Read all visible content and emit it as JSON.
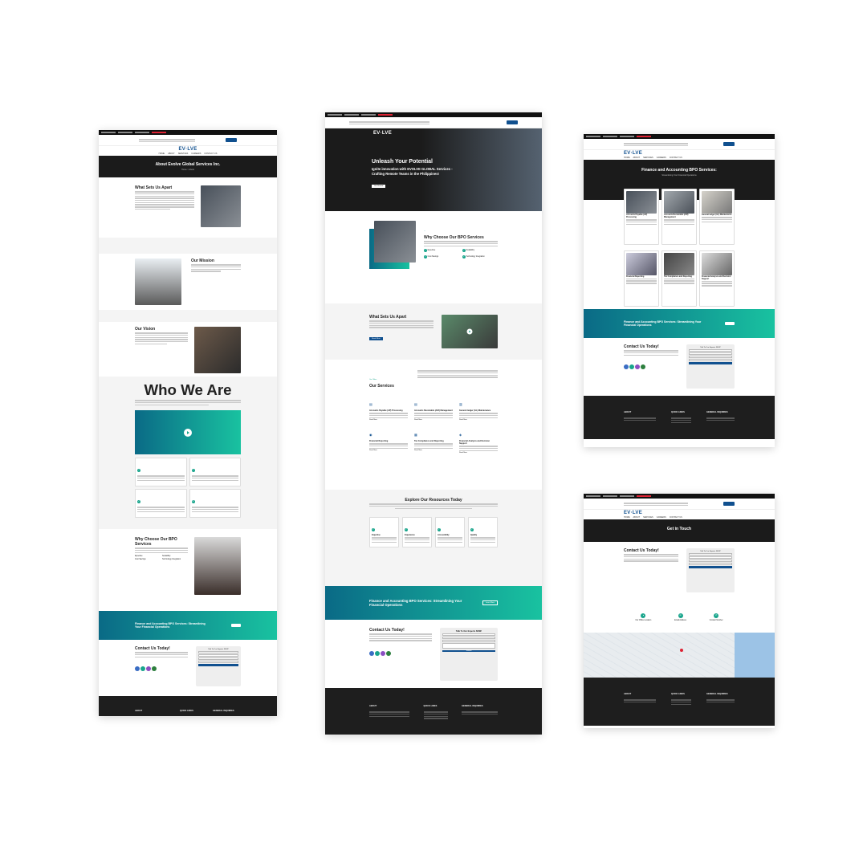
{
  "brand": {
    "logo": "EV·LVE",
    "primary": "#10508f",
    "accent": "#19c2a0",
    "dark": "#1e1e1e"
  },
  "nav": [
    "HOME",
    "ABOUT",
    "SERVICES",
    "CAREERS",
    "CONTACT US"
  ],
  "about_page": {
    "hero_title": "About Evolve Global Services Inc.",
    "hero_breadcrumb": "Home > About",
    "sets_apart": "What Sets Us Apart",
    "mission": "Our Mission",
    "vision": "Our Vision",
    "who_we_are": "Who We Are",
    "why_choose": "Why Choose Our BPO Services",
    "why_items": [
      "Expertise",
      "Scalability",
      "Cost Savings",
      "Technology Integration"
    ],
    "banner": "Finance and Accounting BPO Services: Streamlining Your Financial Operations",
    "contact": "Contact Us Today!",
    "form_title": "Talk To Our Experts NOW!",
    "footer": [
      "ABOUT",
      "QUICK LINKS",
      "GENERAL INQUIRIES"
    ]
  },
  "home_page": {
    "hero_title": "Unleash Your Potential",
    "hero_sub": "Ignite innovation with EVOLVE GLOBAL Services - Crafting Remote Teams in the Philippines!",
    "hero_btn": "Get Started",
    "why_choose": "Why Choose Our BPO Services",
    "why_items": [
      "Expertise",
      "Scalability",
      "Cost Savings",
      "Technology Integration"
    ],
    "sets_apart": "What Sets Us Apart",
    "sets_btn": "Read More",
    "services_tag": "Our Offers",
    "services": "Our Services",
    "service_items": [
      "Accounts Payable (AP) Processing",
      "Accounts Receivable (A/R) Management",
      "General ledger (GL) Maintenance",
      "Financial Reporting",
      "Tax Compliance and Reporting",
      "Financial Analysis and Decision Support"
    ],
    "read_more": "Read More",
    "resources": "Explore Our Resources Today",
    "resource_items": [
      "Expertise",
      "Experience",
      "Accessibility",
      "Quality"
    ],
    "banner": "Finance and Accounting BPO Services: Streamlining Your Financial Operations",
    "banner_btn": "Learn More",
    "contact": "Contact Us Today!",
    "form_title": "Talk To Our Experts NOW!",
    "form_btn": "Submit",
    "footer": [
      "ABOUT",
      "QUICK LINKS",
      "GENERAL INQUIRIES"
    ]
  },
  "services_page": {
    "hero_title": "Finance and Accounting BPO Services:",
    "hero_sub": "Streamlining Your Financial Operations",
    "service_items": [
      "Accounts Payable (AP) Processing",
      "Accounts Receivable (A/R) Management",
      "General ledger (GL) Maintenance",
      "Financial Reporting",
      "Tax Compliance and Reporting",
      "Financial Analysis and Decision Support"
    ],
    "banner": "Finance and Accounting BPO Services: Streamlining Your Financial Operations",
    "contact": "Contact Us Today!",
    "form_title": "Talk To Our Experts NOW!"
  },
  "contact_page": {
    "hero_title": "Get in Touch",
    "contact": "Contact Us Today!",
    "form_title": "Talk To Our Experts NOW!",
    "info_items": [
      "Our Office Location",
      "Email Address",
      "Contact Number"
    ]
  }
}
